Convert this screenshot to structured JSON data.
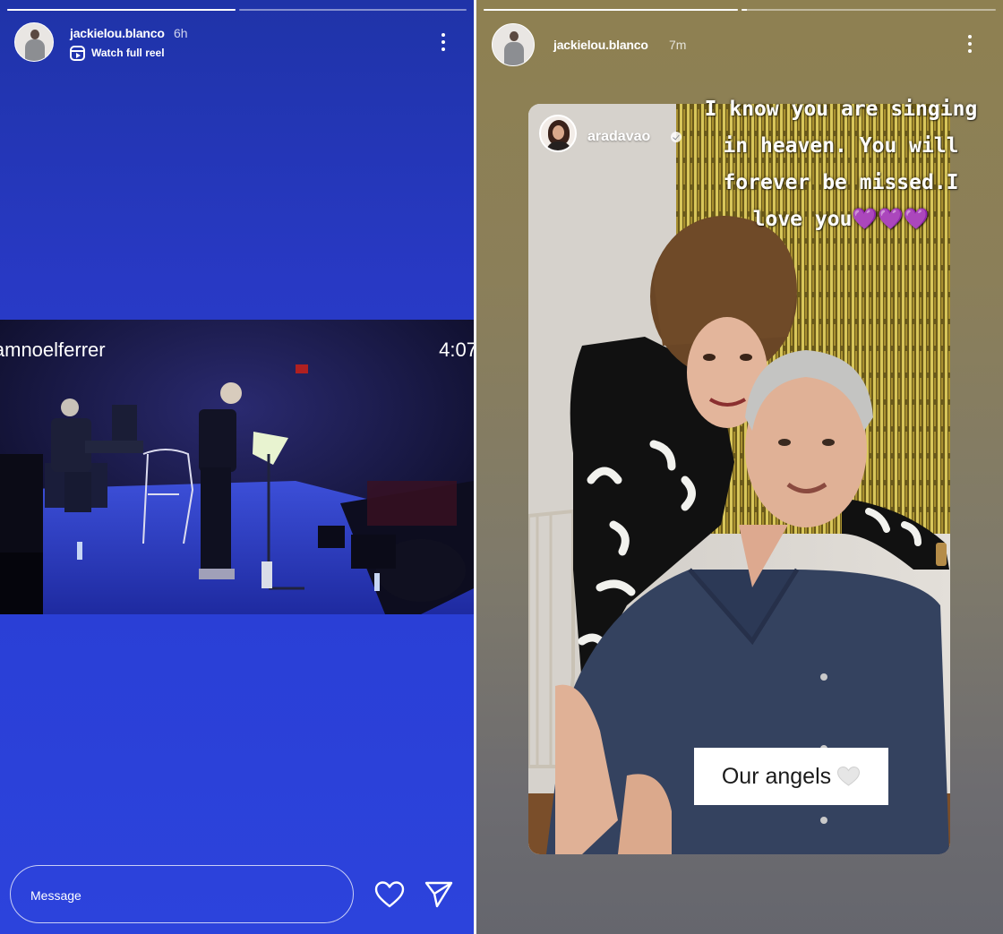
{
  "left_story": {
    "username": "jackielou.blanco",
    "time_ago": "6h",
    "watch_full_reel": "Watch full reel",
    "progress": [
      1.0,
      0.0
    ],
    "video": {
      "handle_text": "iamnoelferrer",
      "duration": "4:07"
    },
    "message_placeholder": "Message",
    "background_color": "#2a3fd6"
  },
  "right_story": {
    "username": "jackielou.blanco",
    "time_ago": "7m",
    "progress": [
      1.0,
      0.02
    ],
    "repost": {
      "username": "aradavao",
      "verified": true
    },
    "caption_line_1": "I know you are singing",
    "caption_line_2": "in heaven. You will",
    "caption_line_3": "forever be missed.I",
    "caption_line_4": "love you",
    "caption_emoji": "💜💜💜",
    "sticker_text": "Our angels",
    "background_color": "#8b7f59"
  },
  "icons": {
    "more": "more-vertical-icon",
    "reel": "reel-icon",
    "like": "heart-icon",
    "share": "send-icon",
    "verified": "verified-badge-icon"
  }
}
